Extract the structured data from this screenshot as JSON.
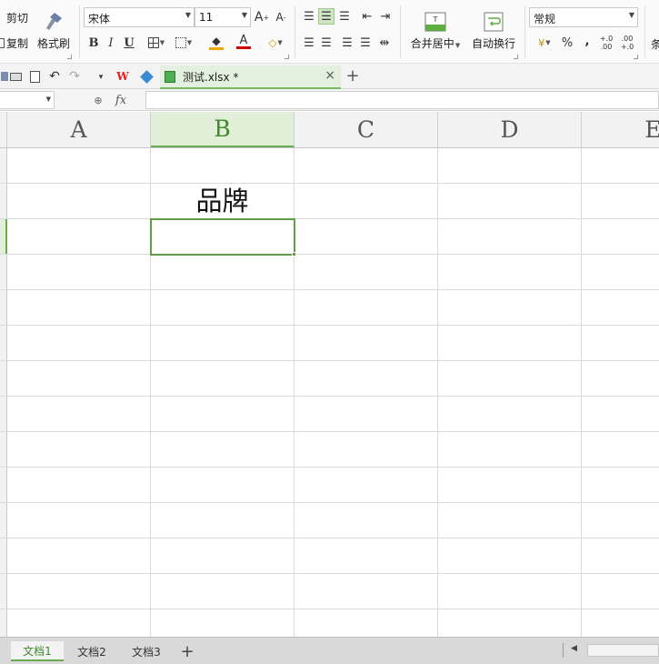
{
  "ribbon": {
    "clipboard": {
      "cut_label": "剪切",
      "copy_label": "复制",
      "format_painter_label": "格式刷"
    },
    "font": {
      "font_name": "宋体",
      "font_size": "11",
      "bold": "B",
      "italic": "I",
      "underline": "U",
      "grow": "A",
      "shrink": "A",
      "font_color_glyph": "A"
    },
    "merge_label": "合并居中",
    "wrap_label": "自动换行",
    "number_format": "常规",
    "percent": "%",
    "comma": ",",
    "inc_decimal": "+.0\n.00",
    "dec_decimal": ".00\n+.0",
    "cut_off_label": "条"
  },
  "quick_access": {
    "document_tab": {
      "name": "测试.xlsx *",
      "close": "×"
    },
    "new_tab": "+",
    "overflow": "▾"
  },
  "formula_bar": {
    "name_box_value": "",
    "fx_label": "fx",
    "formula_value": ""
  },
  "grid": {
    "columns": [
      "A",
      "B",
      "C",
      "D",
      "E"
    ],
    "active_column": "B",
    "cells": {
      "B2": "品牌"
    }
  },
  "sheet_tabs": {
    "tabs": [
      "文档1",
      "文档2",
      "文档3"
    ],
    "active": "文档1",
    "add": "+"
  },
  "colors": {
    "accent": "#6aaa52",
    "accent_dark": "#3d8a2a",
    "selection_bg": "#e1efd9"
  }
}
